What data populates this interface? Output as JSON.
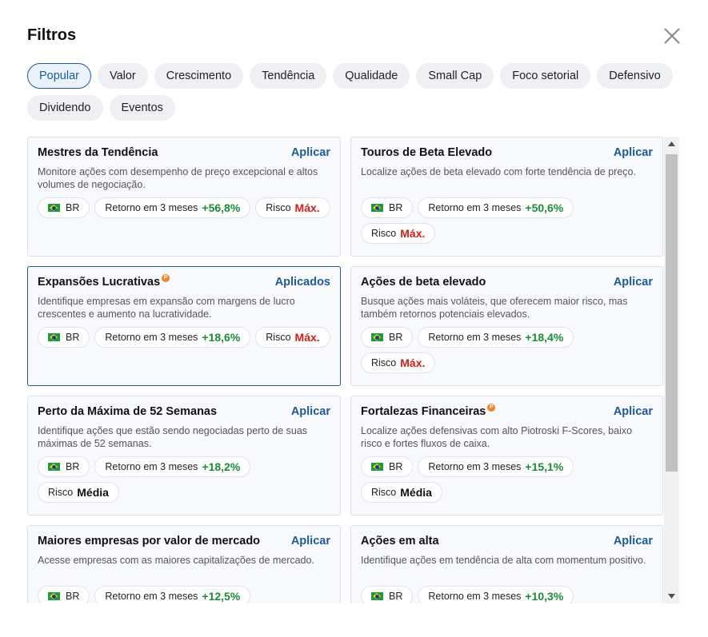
{
  "header": {
    "title": "Filtros"
  },
  "tabs": [
    {
      "label": "Popular",
      "active": true
    },
    {
      "label": "Valor"
    },
    {
      "label": "Crescimento"
    },
    {
      "label": "Tendência"
    },
    {
      "label": "Qualidade"
    },
    {
      "label": "Small Cap"
    },
    {
      "label": "Foco setorial"
    },
    {
      "label": "Defensivo"
    },
    {
      "label": "Dividendo"
    },
    {
      "label": "Eventos"
    }
  ],
  "labels": {
    "country": "BR",
    "return": "Retorno em 3 meses",
    "risk": "Risco"
  },
  "cards": [
    {
      "title": "Mestres da Tendência",
      "action": "Aplicar",
      "desc": "Monitore ações com desempenho de preço excepcional e altos volumes de negociação.",
      "return": "+56,8%",
      "risk": "Máx.",
      "pro": false
    },
    {
      "title": "Touros de Beta Elevado",
      "action": "Aplicar",
      "desc": "Localize ações de beta elevado com forte tendência de preço.",
      "return": "+50,6%",
      "risk": "Máx.",
      "pro": false
    },
    {
      "title": "Expansões Lucrativas",
      "action": "Aplicados",
      "desc": "Identifique empresas em expansão com margens de lucro crescentes e aumento na lucratividade.",
      "return": "+18,6%",
      "risk": "Máx.",
      "pro": true,
      "selected": true
    },
    {
      "title": "Ações de beta elevado",
      "action": "Aplicar",
      "desc": "Busque ações mais voláteis, que oferecem maior risco, mas também retornos potenciais elevados.",
      "return": "+18,4%",
      "risk": "Máx.",
      "pro": false
    },
    {
      "title": "Perto da Máxima de 52 Semanas",
      "action": "Aplicar",
      "desc": "Identifique ações que estão sendo negociadas perto de suas máximas de 52 semanas.",
      "return": "+18,2%",
      "risk": "Média",
      "pro": false
    },
    {
      "title": "Fortalezas Financeiras",
      "action": "Aplicar",
      "desc": "Localize ações defensivas com alto Piotroski F-Scores, baixo risco e fortes fluxos de caixa.",
      "return": "+15,1%",
      "risk": "Média",
      "pro": true
    },
    {
      "title": "Maiores empresas por valor de mercado",
      "action": "Aplicar",
      "desc": "Acesse empresas com as maiores capitalizações de mercado.",
      "return": "+12,5%",
      "risk": "",
      "pro": false
    },
    {
      "title": "Ações em alta",
      "action": "Aplicar",
      "desc": "Identifique ações em tendência de alta com momentum positivo.",
      "return": "+10,3%",
      "risk": "",
      "pro": false
    }
  ],
  "colors": {
    "accent": "#1f5a96",
    "positive": "#1b8a3a",
    "risk_max": "#d0201b"
  },
  "icons": {
    "close": "close-icon",
    "pro": "pro-badge-icon",
    "flag": "brazil-flag-icon"
  }
}
